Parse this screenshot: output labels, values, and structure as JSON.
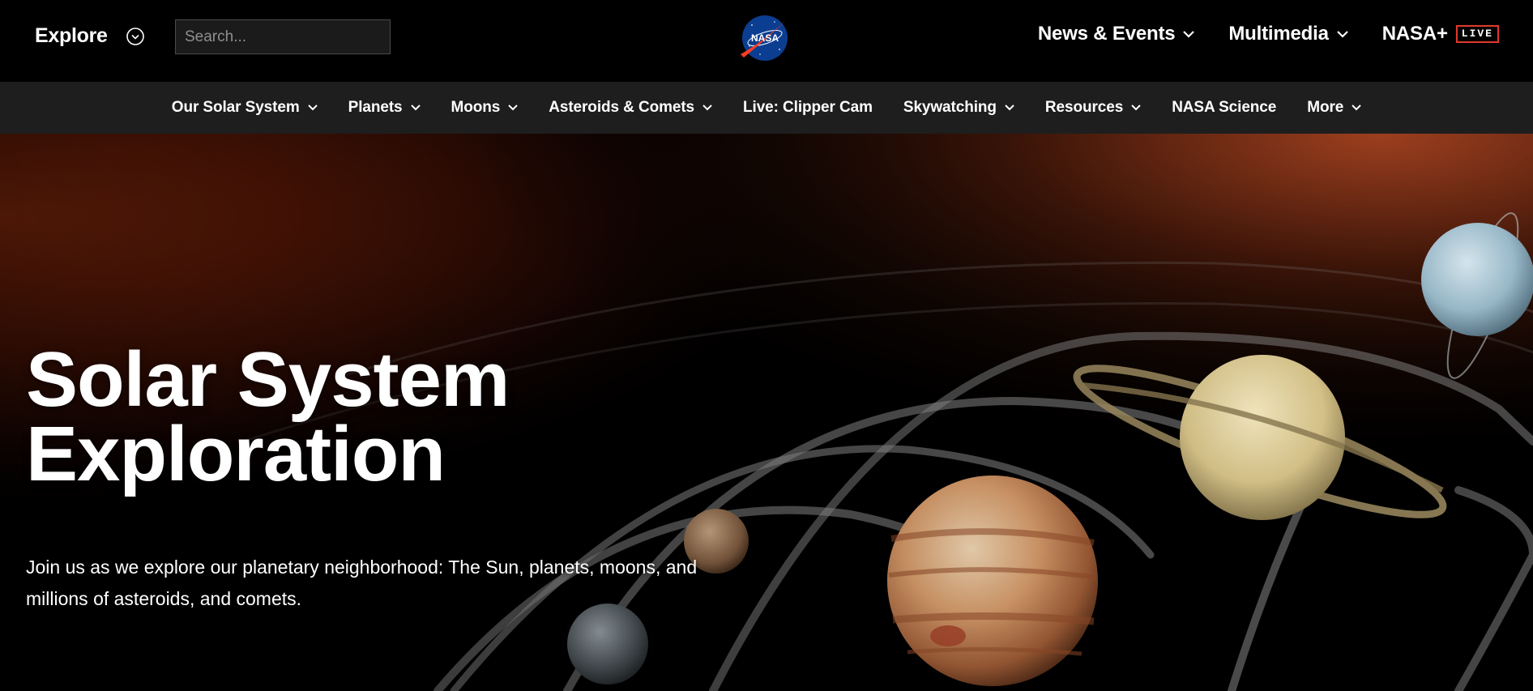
{
  "header": {
    "explore_label": "Explore",
    "search_placeholder": "Search...",
    "logo_text": "NASA",
    "nav": [
      {
        "label": "News & Events"
      },
      {
        "label": "Multimedia"
      },
      {
        "label": "NASA+",
        "badge": "LIVE"
      }
    ]
  },
  "subnav": {
    "items": [
      {
        "label": "Our Solar System"
      },
      {
        "label": "Planets"
      },
      {
        "label": "Moons"
      },
      {
        "label": "Asteroids & Comets"
      },
      {
        "label": "Live: Clipper Cam"
      },
      {
        "label": "Skywatching"
      },
      {
        "label": "Resources"
      },
      {
        "label": "NASA Science"
      },
      {
        "label": "More"
      }
    ]
  },
  "hero": {
    "title_line1": "Solar System",
    "title_line2": "Exploration",
    "description": "Join us as we explore our planetary neighborhood: The Sun, planets, moons, and millions of asteroids, and comets."
  },
  "colors": {
    "header_bg": "#000000",
    "subnav_bg": "#1e1e1e",
    "live_badge_border": "#e2382b",
    "nasa_blue": "#0b3d91",
    "nasa_red": "#fc3d21"
  },
  "icons": {
    "explore": "chevron-circle-down-icon",
    "dropdown": "chevron-down-icon"
  }
}
